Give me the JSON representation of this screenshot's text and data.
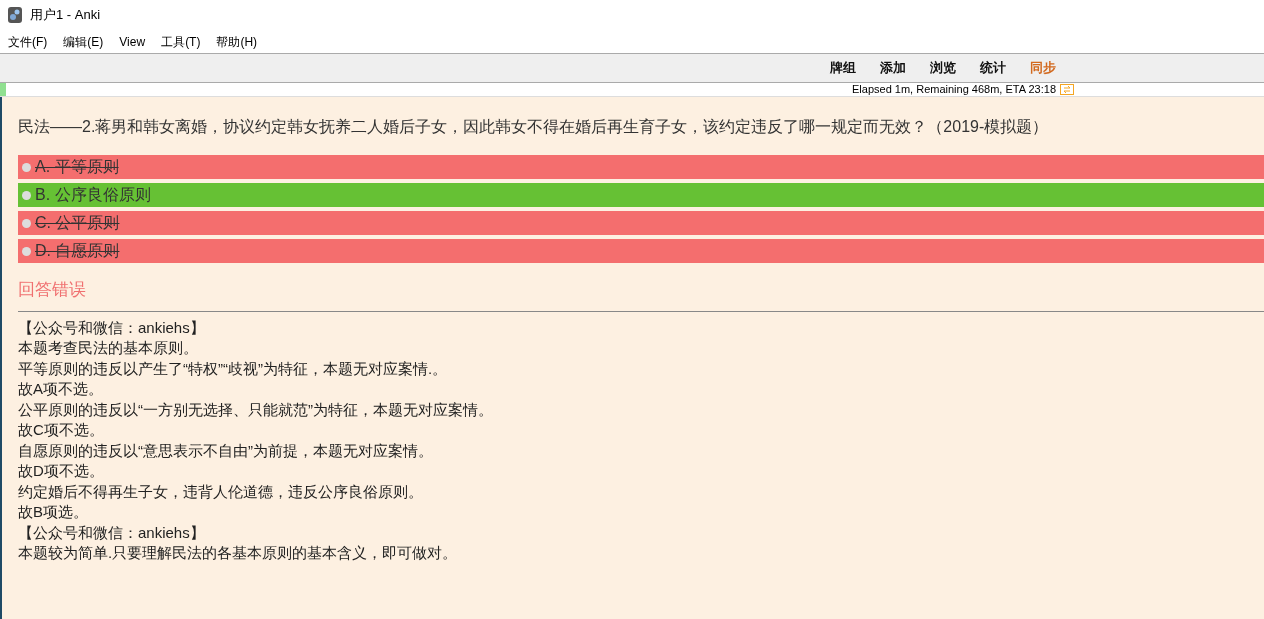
{
  "window": {
    "title": "用户1 - Anki"
  },
  "menu": [
    "文件(F)",
    "编辑(E)",
    "View",
    "工具(T)",
    "帮助(H)"
  ],
  "toolbar": [
    {
      "label": "牌组",
      "kind": "normal"
    },
    {
      "label": "添加",
      "kind": "normal"
    },
    {
      "label": "浏览",
      "kind": "normal"
    },
    {
      "label": "统计",
      "kind": "normal"
    },
    {
      "label": "同步",
      "kind": "sync"
    }
  ],
  "progress": {
    "text": "Elapsed 1m, Remaining 468m, ETA 23:18",
    "level": 0.005
  },
  "question": "民法——2.蒋男和韩女离婚，协议约定韩女抚养二人婚后子女，因此韩女不得在婚后再生育子女，该约定违反了哪一规定而无效？（2019-模拟题）",
  "options": [
    {
      "label": "A. 平等原则",
      "kind": "wrong"
    },
    {
      "label": "B. 公序良俗原则",
      "kind": "correct"
    },
    {
      "label": "C. 公平原则",
      "kind": "wrong"
    },
    {
      "label": "D. 自愿原则",
      "kind": "wrong"
    }
  ],
  "result": "回答错误",
  "explanation": [
    "【公众号和微信：ankiehs】",
    "本题考查民法的基本原则。",
    "平等原则的违反以产生了“特权”“歧视”为特征，本题无对应案情.。",
    "故A项不选。",
    "公平原则的违反以“一方别无选择、只能就范”为特征，本题无对应案情。",
    "故C项不选。",
    "自愿原则的违反以“意思表示不自由”为前提，本题无对应案情。",
    "故D项不选。",
    "约定婚后不得再生子女，违背人伦道德，违反公序良俗原则。",
    "故B项选。",
    "【公众号和微信：ankiehs】",
    "本题较为简单.只要理解民法的各基本原则的基本含义，即可做对。"
  ]
}
